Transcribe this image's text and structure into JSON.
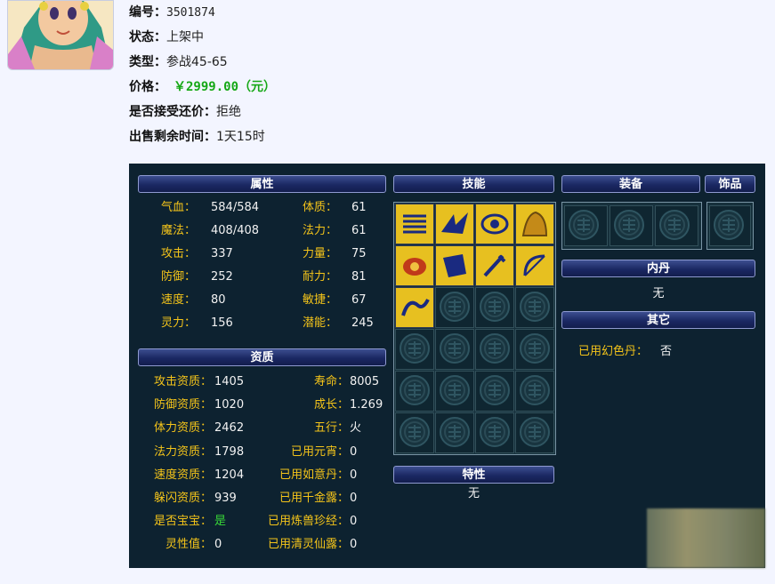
{
  "header": {
    "avatar_label": "pet-portrait",
    "id_label": "编号：",
    "id_value": "3501874",
    "status_label": "状态：",
    "status_value": "上架中",
    "type_label": "类型：",
    "type_value": "参战45-65",
    "price_label": "价格：",
    "price_value": "￥2999.00（元）",
    "bargain_label": "是否接受还价：",
    "bargain_value": "拒绝",
    "time_label": "出售剩余时间：",
    "time_value": "1天15时"
  },
  "sections": {
    "attributes": "属性",
    "aptitude": "资质",
    "skills": "技能",
    "equipment": "装备",
    "accessory": "饰品",
    "inner_dan": "内丹",
    "others": "其它",
    "traits": "特性"
  },
  "attributes": [
    {
      "label": "气血：",
      "value": "584/584"
    },
    {
      "label": "体质：",
      "value": "61"
    },
    {
      "label": "魔法：",
      "value": "408/408"
    },
    {
      "label": "法力：",
      "value": "61"
    },
    {
      "label": "攻击：",
      "value": "337"
    },
    {
      "label": "力量：",
      "value": "75"
    },
    {
      "label": "防御：",
      "value": "252"
    },
    {
      "label": "耐力：",
      "value": "81"
    },
    {
      "label": "速度：",
      "value": "80"
    },
    {
      "label": "敏捷：",
      "value": "67"
    },
    {
      "label": "灵力：",
      "value": "156"
    },
    {
      "label": "潜能：",
      "value": "245"
    }
  ],
  "aptitude": [
    {
      "label": "攻击资质：",
      "value": "1405"
    },
    {
      "label": "寿命：",
      "value": "8005"
    },
    {
      "label": "防御资质：",
      "value": "1020"
    },
    {
      "label": "成长：",
      "value": "1.269"
    },
    {
      "label": "体力资质：",
      "value": "2462"
    },
    {
      "label": "五行：",
      "value": "火"
    },
    {
      "label": "法力资质：",
      "value": "1798"
    },
    {
      "label": "已用元宵：",
      "value": "0"
    },
    {
      "label": "速度资质：",
      "value": "1204"
    },
    {
      "label": "已用如意丹：",
      "value": "0"
    },
    {
      "label": "躲闪资质：",
      "value": "939"
    },
    {
      "label": "已用千金露：",
      "value": "0"
    },
    {
      "label": "是否宝宝：",
      "value": "是"
    },
    {
      "label": "已用炼兽珍经：",
      "value": "0"
    },
    {
      "label": "灵性值：",
      "value": "0"
    },
    {
      "label": "已用清灵仙露：",
      "value": "0"
    }
  ],
  "inner_dan_value": "无",
  "others": {
    "label": "已用幻色丹：",
    "value": "否"
  },
  "traits_value": "无",
  "skill_icons": [
    "wind-scroll-icon",
    "blue-bird-icon",
    "eye-ring-icon",
    "flame-tiger-icon",
    "red-turtle-icon",
    "blue-beast-icon",
    "golden-sword-icon",
    "bow-arrow-icon",
    "blue-wave-icon"
  ],
  "colors": {
    "label": "#f4c41a",
    "value": "#f2f2f2",
    "panel": "#0d2230",
    "price": "#16a816",
    "skill_bg": "#e7c020"
  }
}
